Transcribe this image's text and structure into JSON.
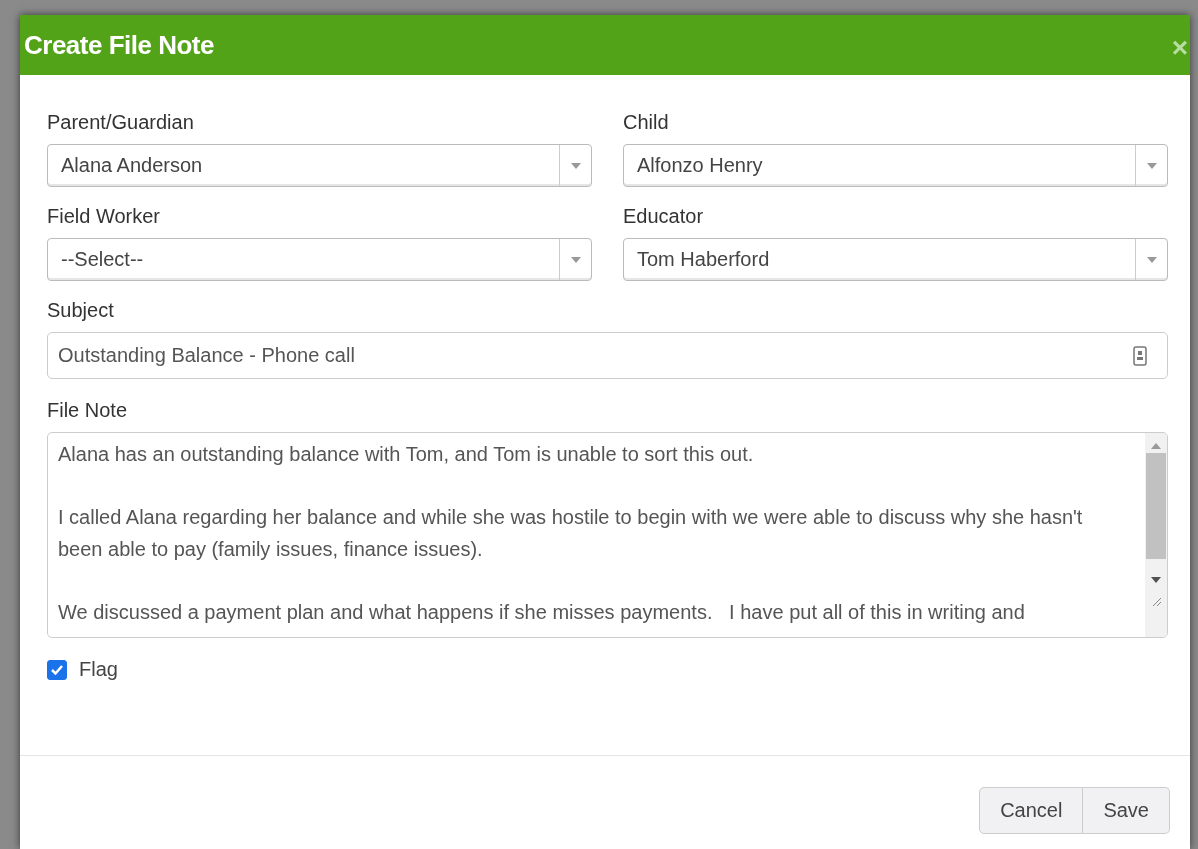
{
  "dialog": {
    "title": "Create File Note",
    "close": "×"
  },
  "selects": [
    {
      "label": "Parent/Guardian",
      "value": "Alana Anderson"
    },
    {
      "label": "Child",
      "value": "Alfonzo Henry"
    },
    {
      "label": "Field Worker",
      "value": "--Select--"
    },
    {
      "label": "Educator",
      "value": "Tom Haberford"
    }
  ],
  "subject": {
    "label": "Subject",
    "value": "Outstanding Balance - Phone call"
  },
  "file_note": {
    "label": "File Note",
    "value": "Alana has an outstanding balance with Tom, and Tom is unable to sort this out.\n\nI called Alana regarding her balance and while she was hostile to begin with we were able to discuss why she hasn't been able to pay (family issues, finance issues).\n\nWe discussed a payment plan and what happens if she misses payments.   I have put all of this in writing and"
  },
  "flag": {
    "label": "Flag",
    "checked": true
  },
  "buttons": [
    "Cancel",
    "Save"
  ]
}
